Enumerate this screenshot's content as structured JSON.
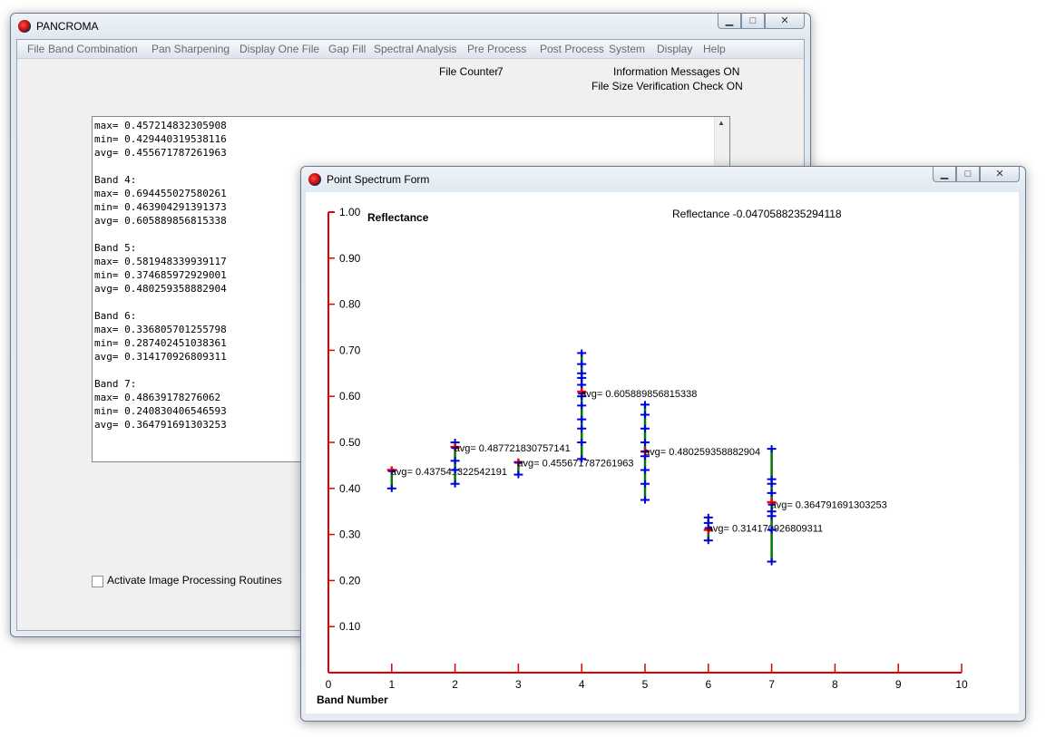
{
  "main_window": {
    "title": "PANCROMA",
    "menu": [
      "File",
      "Band Combination",
      "Pan Sharpening",
      "Display One File",
      "Gap Fill",
      "Spectral Analysis",
      "Pre Process",
      "Post Process",
      "System",
      "Display",
      "Help"
    ],
    "file_counter_label": "File Counter",
    "file_counter_value": "7",
    "info_messages": "Information  Messages ON",
    "file_size_check": "File Size Verification Check  ON",
    "text_output": "max= 0.457214832305908\nmin= 0.429440319538116\navg= 0.455671787261963\n\nBand 4:\nmax= 0.694455027580261\nmin= 0.463904291391373\navg= 0.605889856815338\n\nBand 5:\nmax= 0.581948339939117\nmin= 0.374685972929001\navg= 0.480259358882904\n\nBand 6:\nmax= 0.336805701255798\nmin= 0.287402451038361\navg= 0.314170926809311\n\nBand 7:\nmax= 0.48639178276062\nmin= 0.240830406546593\navg= 0.364791691303253",
    "activate_label": "Activate Image Processing Routines"
  },
  "spectrum_window": {
    "title": "Point Spectrum Form",
    "y_title": "Reflectance",
    "readout": "Reflectance  -0.0470588235294118",
    "x_title": "Band Number"
  },
  "caption_icons": [
    "minimize-icon",
    "maximize-icon",
    "close-icon"
  ],
  "colors": {
    "axis": "#e00000",
    "marker": "#0000e0",
    "highlight": "#ff0000",
    "range": "#007a00"
  },
  "chart_data": {
    "type": "scatter",
    "xlabel": "Band Number",
    "ylabel": "Reflectance",
    "xlim": [
      0,
      10
    ],
    "ylim": [
      0,
      1.0
    ],
    "x_ticks": [
      "0",
      "1",
      "2",
      "3",
      "4",
      "5",
      "6",
      "7",
      "8",
      "9",
      "10"
    ],
    "y_ticks": [
      "0.10",
      "0.20",
      "0.30",
      "0.40",
      "0.50",
      "0.60",
      "0.70",
      "0.80",
      "0.90",
      "1.00"
    ],
    "bands": [
      {
        "band": 1,
        "min": 0.4,
        "max": 0.44,
        "avg": 0.4375,
        "label": "avg= 0.437541322542191",
        "points": [
          0.4,
          0.44
        ],
        "highlight": 0.44
      },
      {
        "band": 2,
        "min": 0.41,
        "max": 0.5,
        "avg": 0.4877,
        "label": "avg= 0.487721830757141",
        "points": [
          0.41,
          0.44,
          0.46,
          0.49,
          0.5
        ],
        "highlight": 0.49
      },
      {
        "band": 3,
        "min": 0.43,
        "max": 0.457,
        "avg": 0.4557,
        "label": "avg= 0.455671787261963",
        "points": [
          0.43,
          0.457
        ],
        "highlight": 0.457
      },
      {
        "band": 4,
        "min": 0.464,
        "max": 0.694,
        "avg": 0.6059,
        "label": "avg= 0.605889856815338",
        "points": [
          0.464,
          0.5,
          0.53,
          0.55,
          0.58,
          0.6,
          0.625,
          0.64,
          0.65,
          0.67,
          0.694
        ],
        "highlight": 0.61
      },
      {
        "band": 5,
        "min": 0.375,
        "max": 0.582,
        "avg": 0.4803,
        "label": "avg= 0.480259358882904",
        "points": [
          0.375,
          0.41,
          0.44,
          0.47,
          0.5,
          0.53,
          0.56,
          0.582
        ],
        "highlight": 0.48
      },
      {
        "band": 6,
        "min": 0.287,
        "max": 0.337,
        "avg": 0.3142,
        "label": "avg= 0.314170926809311",
        "points": [
          0.287,
          0.31,
          0.325,
          0.337
        ],
        "highlight": 0.31
      },
      {
        "band": 7,
        "min": 0.241,
        "max": 0.486,
        "avg": 0.3648,
        "label": "avg= 0.364791691303253",
        "points": [
          0.241,
          0.31,
          0.34,
          0.35,
          0.37,
          0.39,
          0.41,
          0.42,
          0.486
        ],
        "highlight": 0.37
      }
    ]
  }
}
